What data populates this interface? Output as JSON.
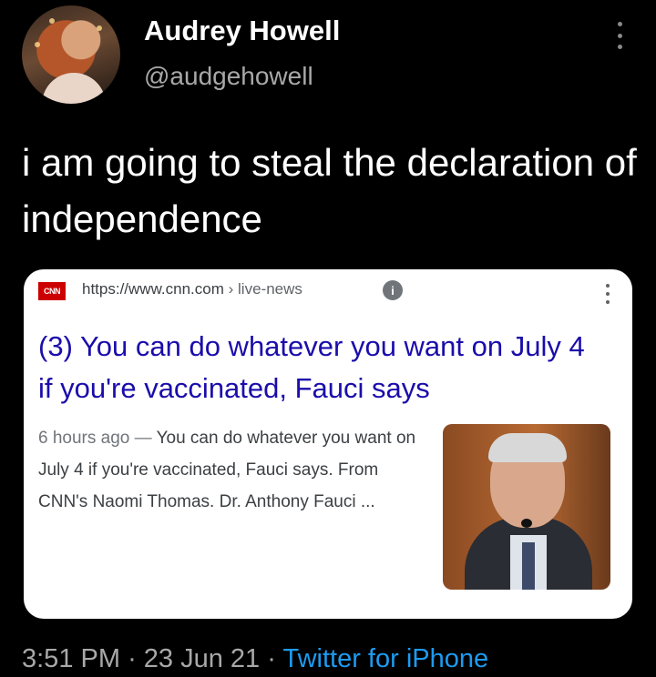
{
  "author": {
    "name": "Audrey Howell",
    "handle": "@audgehowell",
    "avatar_icon": "profile-photo"
  },
  "tweet": {
    "text": "i am going to steal the declaration of independence"
  },
  "link_card": {
    "favicon_text": "CNN",
    "url_domain": "https://www.cnn.com",
    "url_separator": "›",
    "url_path": "live-news",
    "headline": "(3) You can do whatever you want on July 4 if you're vaccinated, Fauci says",
    "time_ago": "6 hours ago",
    "snippet_dash": "—",
    "snippet": "You can do whatever you want on July 4 if you're vaccinated, Fauci says. From CNN's Naomi Thomas. Dr. Anthony Fauci ...",
    "thumbnail_icon": "news-photo"
  },
  "meta": {
    "time": "3:51 PM",
    "date": "23 Jun 21",
    "separator": "·",
    "source": "Twitter for iPhone"
  },
  "colors": {
    "background": "#000000",
    "headline_link": "#1a0dab",
    "source_link": "#1d9bf0",
    "muted_text": "#a8a8a8"
  }
}
